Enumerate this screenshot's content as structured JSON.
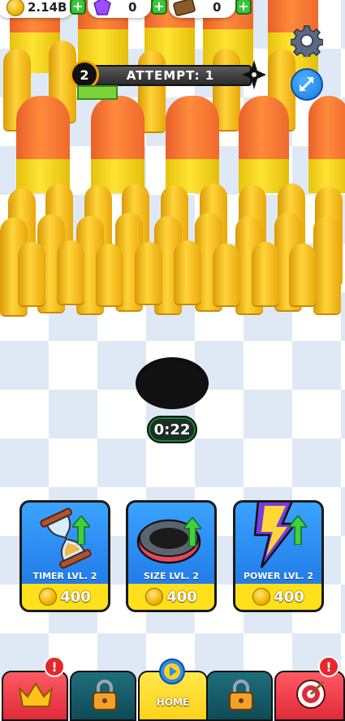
{
  "currencies": [
    {
      "name": "coins",
      "value": "2.14B"
    },
    {
      "name": "gems",
      "value": "0"
    },
    {
      "name": "tickets",
      "value": "0"
    }
  ],
  "hud": {
    "level": "2",
    "attempt_label": "ATTEMPT: 1",
    "timer": "0:22"
  },
  "upgrades": [
    {
      "label": "TIMER LVL. 2",
      "price": "400",
      "icon": "hourglass-icon"
    },
    {
      "label": "SIZE LVL. 2",
      "price": "400",
      "icon": "ring-icon"
    },
    {
      "label": "POWER LVL. 2",
      "price": "400",
      "icon": "lightning-icon"
    }
  ],
  "nav": {
    "home_label": "HOME",
    "alert_mark": "!"
  },
  "colors": {
    "card_blue": "#2f8cf3",
    "price_yellow": "#ffe01a",
    "plus_green": "#3ac43a",
    "shell_orange": "#f5752f",
    "bullet_gold": "#f2c01b",
    "alert_red": "#e8262b"
  }
}
